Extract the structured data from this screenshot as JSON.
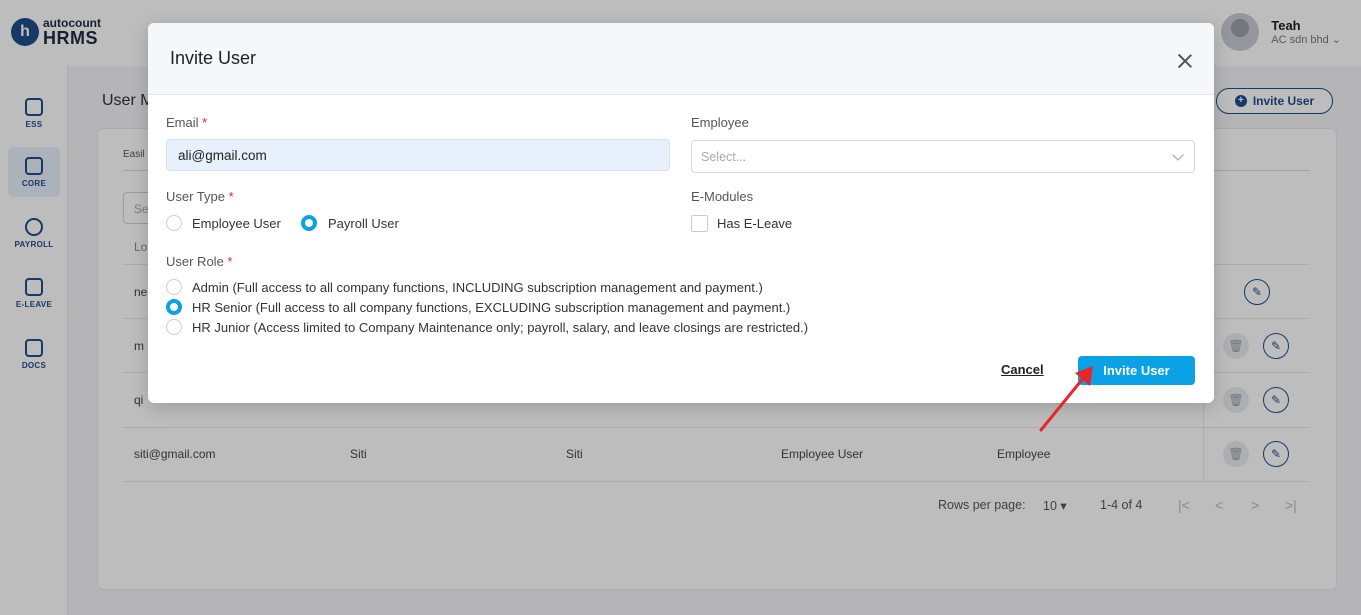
{
  "app": {
    "logo_small": "autocount",
    "logo_big": "HRMS",
    "user_name": "Teah",
    "company": "AC sdn bhd"
  },
  "sidebar": {
    "items": [
      {
        "label": "ESS",
        "icon": "ess-icon"
      },
      {
        "label": "CORE",
        "icon": "core-icon"
      },
      {
        "label": "PAYROLL",
        "icon": "payroll-icon"
      },
      {
        "label": "E-LEAVE",
        "icon": "calendar-icon"
      },
      {
        "label": "DOCS",
        "icon": "docs-icon"
      }
    ]
  },
  "background": {
    "page_title": "User M",
    "invite_button": "Invite User",
    "tab_fragment": "Easil",
    "search_fragment": "Se",
    "column_fragment": "Lo",
    "rows": [
      {
        "email": "ne",
        "name": "",
        "display": "",
        "type": "",
        "role": ""
      },
      {
        "email": "m",
        "name": "",
        "display": "",
        "type": "",
        "role": ""
      },
      {
        "email": "qi",
        "name": "",
        "display": "",
        "type": "",
        "role": ""
      },
      {
        "email": "siti@gmail.com",
        "name": "Siti",
        "display": "Siti",
        "type": "Employee User",
        "role": "Employee"
      }
    ],
    "pager": {
      "rows_per_page_label": "Rows per page:",
      "rows_per_page_value": "10",
      "range": "1-4 of 4"
    }
  },
  "modal": {
    "title": "Invite User",
    "email": {
      "label": "Email",
      "value": "ali@gmail.com"
    },
    "employee": {
      "label": "Employee",
      "placeholder": "Select..."
    },
    "user_type": {
      "label": "User Type",
      "options": [
        {
          "label": "Employee User",
          "selected": false
        },
        {
          "label": "Payroll User",
          "selected": true
        }
      ]
    },
    "e_modules": {
      "label": "E-Modules",
      "options": [
        {
          "label": "Has E-Leave",
          "checked": false
        }
      ]
    },
    "user_role": {
      "label": "User Role",
      "options": [
        {
          "label": "Admin (Full access to all company functions, INCLUDING subscription management and payment.)",
          "selected": false
        },
        {
          "label": "HR Senior (Full access to all company functions, EXCLUDING subscription management and payment.)",
          "selected": true
        },
        {
          "label": "HR Junior (Access limited to Company Maintenance only; payroll, salary, and leave closings are restricted.)",
          "selected": false
        }
      ]
    },
    "cancel_label": "Cancel",
    "submit_label": "Invite User"
  },
  "colors": {
    "accent": "#0aa2e5",
    "brand": "#1f4e8c",
    "required": "#d32f2f",
    "annotation_arrow": "#e8262a"
  }
}
